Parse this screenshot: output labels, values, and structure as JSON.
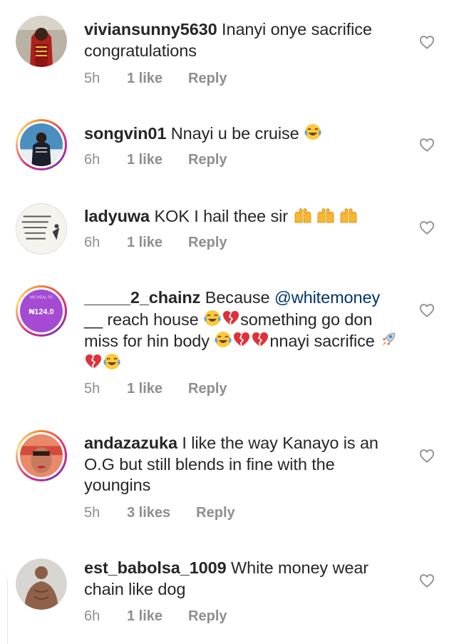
{
  "comments": [
    {
      "username": "viviansunny5630",
      "text": "Inanyi onye sacrifice congratulations",
      "time": "5h",
      "likes": "1 like",
      "reply": "Reply",
      "avatar_ring": false
    },
    {
      "username": "songvin01",
      "text": "Nnayi u be cruise",
      "emojis": [
        "face-with-tears-of-joy"
      ],
      "time": "6h",
      "likes": "1 like",
      "reply": "Reply",
      "avatar_ring": true
    },
    {
      "username": "ladyuwa",
      "text": "KOK I hail thee sir",
      "emojis": [
        "raising-hands",
        "raising-hands",
        "raising-hands"
      ],
      "time": "6h",
      "likes": "1 like",
      "reply": "Reply",
      "avatar_ring": false
    },
    {
      "username": "_____2_chainz",
      "text_before_mention": "Because",
      "mention": "@whitemoney",
      "text_parts": [
        "__ reach house",
        "something go don miss for hin body",
        "nnayi sacrifice"
      ],
      "emojis": [
        "face-with-tears-of-joy",
        "broken-heart",
        "face-with-tears-of-joy",
        "broken-heart",
        "broken-heart",
        "rocket",
        "broken-heart",
        "face-with-tears-of-joy"
      ],
      "avatar_text": "₦124.0",
      "avatar_caption": "MICHEAL PE",
      "time": "5h",
      "likes": "1 like",
      "reply": "Reply",
      "avatar_ring": true
    },
    {
      "username": "andazazuka",
      "text": "I like the way Kanayo is an O.G but still blends in fine with the youngins",
      "time": "5h",
      "likes": "3 likes",
      "reply": "Reply",
      "avatar_ring": true
    },
    {
      "username": "est_babolsa_1009",
      "text": "White money wear chain like dog",
      "time": "6h",
      "likes": "1 like",
      "reply": "Reply",
      "avatar_ring": false
    }
  ],
  "colors": {
    "text": "#262626",
    "meta": "#8e8e8e",
    "mention": "#003569",
    "heart_outline": "#8e8e8e"
  },
  "icons": {
    "like": "heart-outline-icon"
  }
}
